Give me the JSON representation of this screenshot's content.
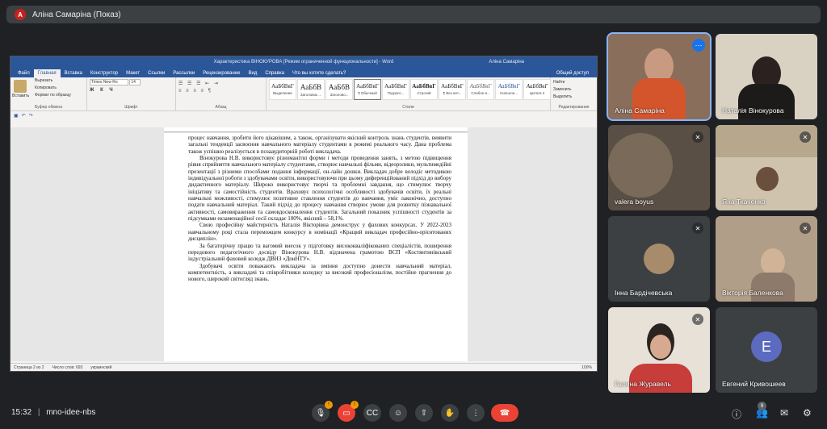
{
  "top_bar": {
    "avatar_letter": "A",
    "title": "Аліна Самаріна (Показ)"
  },
  "word": {
    "window_title": "Характеристика  ВІНОКУРОВА [Режим ограниченной функциональности]  -  Word",
    "user": "Аліна Самаріна",
    "tabs": [
      "Файл",
      "Главная",
      "Вставка",
      "Конструктор",
      "Макет",
      "Ссылки",
      "Рассылки",
      "Рецензирование",
      "Вид",
      "Справка",
      "Что вы хотите сделать?"
    ],
    "share": "Общий доступ",
    "clipboard": {
      "paste": "Вставить",
      "cut": "Вырезать",
      "copy": "Копировать",
      "format": "Формат по образцу",
      "label": "Буфер обмена"
    },
    "font": {
      "name": "Times New Ro",
      "size": "14",
      "label": "Шрифт"
    },
    "paragraph_label": "Абзац",
    "styles_label": "Стили",
    "styles": [
      {
        "sample": "АаБбВвГ",
        "name": "Выделение"
      },
      {
        "sample": "АаБбВ",
        "name": "Заголовок ..."
      },
      {
        "sample": "АаБбВ",
        "name": "Заголово..."
      },
      {
        "sample": "АаБбВвГ",
        "name": "¶ Обычный"
      },
      {
        "sample": "АаБбВвГ",
        "name": "Подзаго..."
      },
      {
        "sample": "АаБбВвГ",
        "name": "Строгий"
      },
      {
        "sample": "АаБбВвГ",
        "name": "¶ Без инт..."
      },
      {
        "sample": "АаБбВвГ",
        "name": "Слабое в..."
      },
      {
        "sample": "АаБбВвГ",
        "name": "Сильное..."
      },
      {
        "sample": "АаБбВвГ",
        "name": "Цитата 2"
      }
    ],
    "editing": {
      "find": "Найти",
      "replace": "Заменить",
      "select": "Выделить",
      "label": "Редактирование"
    },
    "paragraphs": [
      "процес навчання, зробити його цікавішим, а також, організувати якісний контроль знань студентів, виявити загальні тенденції засвоєння навчального матеріалу студентами в режимі реального часу.  Дана проблема також  успішно  реалізується в позааудиторній  роботі викладача.",
      "Вінокурова Н.В. використовує різноманітні форми і методи проведення занять, з метою підвищення рівня сприйняття навчального матеріалу студентами, створює навчальні фільми, відеоролики, мультимедійні презентації з різними способами подання інформації, он-лайн дошки. Викладач добре володіє методикою індивідуальної роботи з здобувачами освіти, використовуючи при цьому диференційований підхід до вибору дидактичного матеріалу. Широко використовує творчі та проблемні завдання, що стимулює творчу ініціативу та самостійність студентів. Враховує психологічні особливості здобувачів освіти, їх реальні навчальні можливості, стимулює позитивне ставлення студентів до навчання, уміє лаконічно, доступно подати навчальний матеріал. Такий підхід до процесу навчання створює умови для розвитку пізнавальної активності, самовираження та самовдосконалення студентів. Загальний показник успішності студентів за підсумками екзаменаційної сесії складає 100%, якісний – 58,1%.",
      "Свою професійну майстерність Наталія Вікторівна демонструє у фахових конкурсах. У 2022-2023 навчальному році стала переможцем  конкурсу в номінації «Кращий викладач професійно-орієнтованих дисциплін».",
      "За багаторічну працю та вагомий внесок у підготовку висококваліфікованих спеціалістів, поширення передового педагогічного досвіду Вінокурова Н.В. відзначена грамотою ВСП «Костянтинівський індустріальний фаховий коледж ДВНЗ «ДонНТУ».",
      "Здобувачі освіти поважають викладача за вміння доступно донести навчальний матеріал, компетентність, а викладачі та співробітники коледжу за високий професіоналізм, постійне прагнення до нового, широкий світогляд знань."
    ],
    "status": {
      "page": "Страница 2 из 2",
      "words": "Число слов: 693",
      "lang": "украинский",
      "zoom": "100%"
    }
  },
  "participants": [
    {
      "name": "Аліна Самаріна",
      "muted": false,
      "active": true
    },
    {
      "name": "Наталія Вінокурова",
      "muted": false
    },
    {
      "name": "valera boyus",
      "muted": true
    },
    {
      "name": "Яна Ткаченко",
      "muted": true
    },
    {
      "name": "Інна Бардічевська",
      "muted": true
    },
    {
      "name": "Вікторія Баленкова",
      "muted": true
    },
    {
      "name": "Галина Журавель",
      "muted": true
    },
    {
      "name": "Евгений Кривошеев",
      "muted": false,
      "avatar_letter": "E"
    }
  ],
  "bottom_bar": {
    "time": "15:32",
    "separator": "|",
    "meeting_code": "mno-idee-nbs",
    "mic_badge": "!",
    "cam_badge": "!",
    "participants_count": "9",
    "chat_badge": ""
  }
}
